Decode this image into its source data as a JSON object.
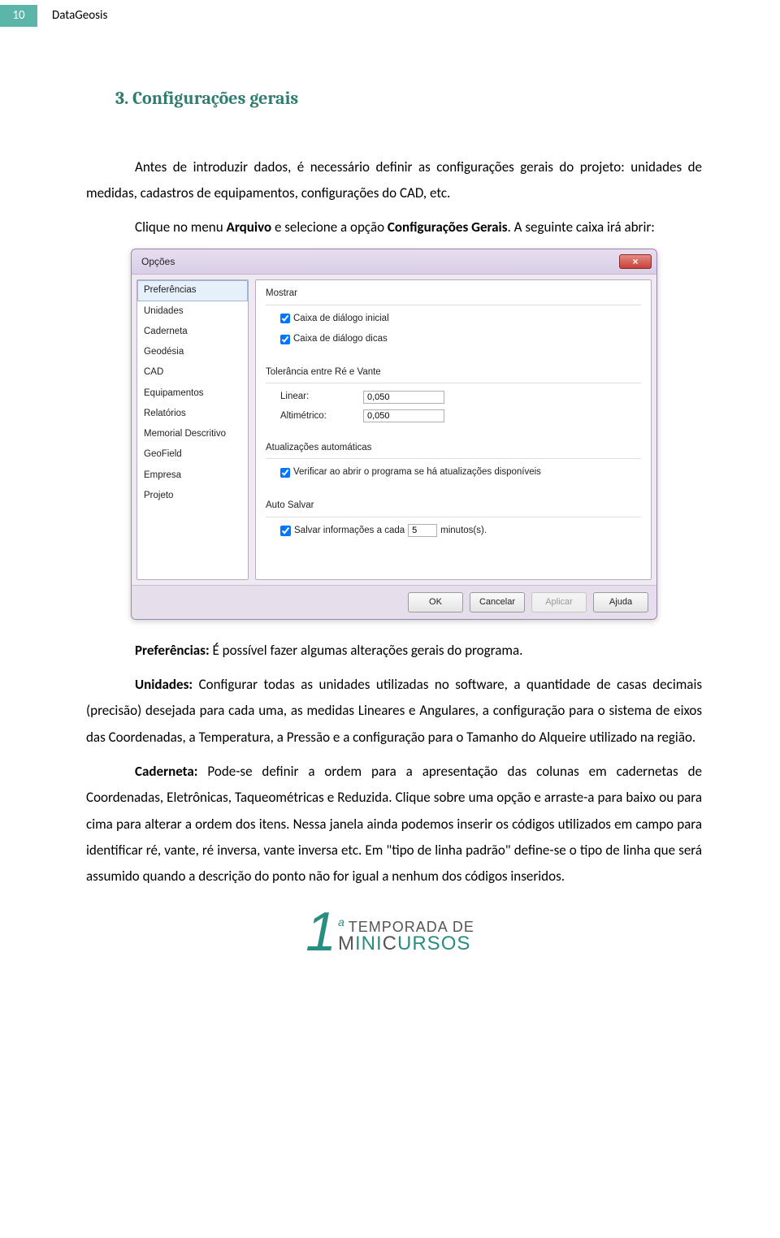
{
  "header": {
    "page_number": "10",
    "doc_title": "DataGeosis"
  },
  "section": {
    "title": "3. Configurações gerais"
  },
  "paragraphs": {
    "p1": "Antes de introduzir dados, é necessário definir as configurações gerais do projeto: unidades de medidas, cadastros de equipamentos, configurações do CAD, etc.",
    "p2a": "Clique no menu ",
    "p2b": "Arquivo",
    "p2c": " e selecione a opção ",
    "p2d": "Configurações Gerais",
    "p2e": ". A seguinte caixa irá abrir:",
    "p3a": "Preferências:",
    "p3b": " É possível fazer algumas alterações gerais do programa.",
    "p4a": "Unidades:",
    "p4b": " Configurar todas as unidades utilizadas no software, a quantidade de casas decimais (precisão) desejada para cada uma, as medidas Lineares e Angulares, a configuração para o sistema de eixos das Coordenadas, a Temperatura, a Pressão e a configuração para o Tamanho do Alqueire utilizado na região.",
    "p5a": "Caderneta:",
    "p5b": " Pode-se definir a ordem para a apresentação das colunas em cadernetas de Coordenadas, Eletrônicas, Taqueométricas e Reduzida. Clique sobre uma opção e arraste-a para baixo ou para cima para alterar a ordem dos itens. Nessa janela ainda podemos inserir os códigos utilizados em campo para identificar ré, vante, ré inversa, vante inversa etc. Em \"tipo de linha padrão\" define-se o tipo de linha que será assumido quando a descrição do ponto não for igual a nenhum dos códigos inseridos."
  },
  "dialog": {
    "title": "Opções",
    "close": "×",
    "sidebar": {
      "items": [
        "Preferências",
        "Unidades",
        "Caderneta",
        "Geodésia",
        "CAD",
        "Equipamentos",
        "Relatórios",
        "Memorial Descritivo",
        "GeoField",
        "Empresa",
        "Projeto"
      ]
    },
    "groups": {
      "mostrar": {
        "title": "Mostrar",
        "chk1": "Caixa de diálogo inicial",
        "chk2": "Caixa de diálogo dicas"
      },
      "tolerancia": {
        "title": "Tolerância entre Ré e Vante",
        "linear_label": "Linear:",
        "linear_value": "0,050",
        "alt_label": "Altimétrico:",
        "alt_value": "0,050"
      },
      "atualizacoes": {
        "title": "Atualizações automáticas",
        "chk": "Verificar ao abrir o programa se há atualizações disponíveis"
      },
      "autosave": {
        "title": "Auto Salvar",
        "chk_pre": "Salvar informações a cada",
        "value": "5",
        "chk_post": "minutos(s)."
      }
    },
    "buttons": {
      "ok": "OK",
      "cancel": "Cancelar",
      "apply": "Aplicar",
      "help": "Ajuda"
    }
  },
  "logo": {
    "one": "1",
    "ord": "a",
    "top": "TEMPORADA DE",
    "bottom_m": "M",
    "bottom_rest": "INI",
    "bottom_c": "C",
    "bottom_rest2": "URSOS"
  }
}
